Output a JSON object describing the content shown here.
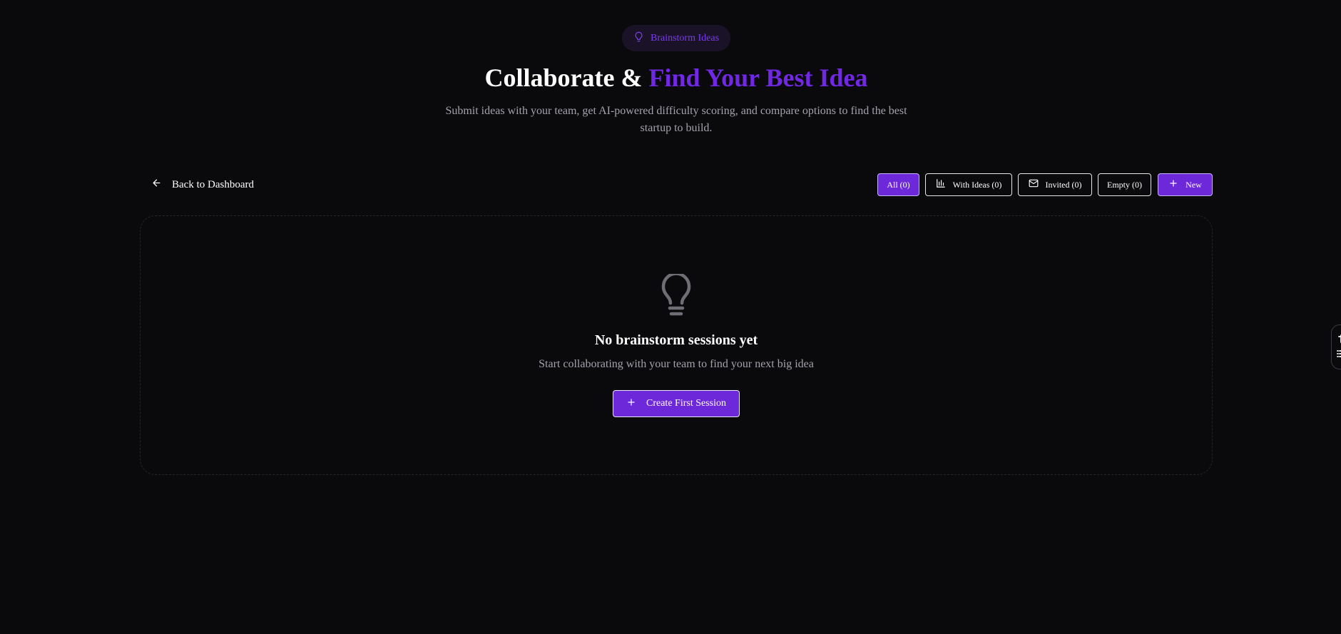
{
  "header": {
    "badge_label": "Brainstorm Ideas",
    "badge_icon": "lightbulb-icon",
    "title_main": "Collaborate & ",
    "title_accent": "Find Your Best Idea",
    "subtitle": "Submit ideas with your team, get AI-powered difficulty scoring, and compare options to find the best startup to build."
  },
  "toolbar": {
    "back_label": "Back to Dashboard",
    "filters": [
      {
        "label": "All (0)",
        "active": true
      },
      {
        "label": "With Ideas (0)",
        "icon": "bar-chart-icon",
        "active": false
      },
      {
        "label": "Invited (0)",
        "icon": "mail-icon",
        "active": false
      },
      {
        "label": "Empty (0)",
        "active": false
      }
    ],
    "new_label": "New"
  },
  "empty_state": {
    "icon": "lightbulb-icon",
    "title": "No brainstorm sessions yet",
    "text": "Start collaborating with your team to find your next big idea",
    "button_label": "Create First Session"
  },
  "colors": {
    "background": "#0a0a0c",
    "accent": "#6d28d9",
    "accent_text": "#7028e4",
    "muted_text": "#a3a3ad"
  }
}
